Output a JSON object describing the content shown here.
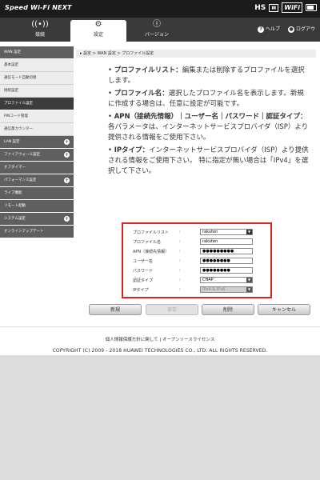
{
  "header": {
    "brand": "Speed Wi-Fi NEXT",
    "network": "HS",
    "wifi_label": "WiFi"
  },
  "nav": {
    "tabs": [
      {
        "label": "接続",
        "icon": "wifi-icon"
      },
      {
        "label": "設定",
        "icon": "gear-icon"
      },
      {
        "label": "バージョン",
        "icon": "info-icon"
      }
    ],
    "help": "ヘルプ",
    "logout": "ログアウ"
  },
  "sidebar": {
    "items": [
      {
        "label": "WAN 設定",
        "type": "section"
      },
      {
        "label": "基本設定",
        "type": "sub"
      },
      {
        "label": "通信モード自動切替",
        "type": "sub"
      },
      {
        "label": "接続設定",
        "type": "sub"
      },
      {
        "label": "プロファイル設定",
        "type": "active"
      },
      {
        "label": "PINコード管理",
        "type": "sub"
      },
      {
        "label": "通信量カウンター",
        "type": "sub"
      },
      {
        "label": "LAN 設定",
        "type": "section",
        "expand": true
      },
      {
        "label": "ファイアウォール設定",
        "type": "section",
        "expand": true
      },
      {
        "label": "オフタイマー",
        "type": "section"
      },
      {
        "label": "パフォーマンス設定",
        "type": "section",
        "expand": true
      },
      {
        "label": "ライブ機能",
        "type": "section"
      },
      {
        "label": "リモート起動",
        "type": "section"
      },
      {
        "label": "システム設定",
        "type": "section",
        "expand": true
      },
      {
        "label": "オンラインアップデート",
        "type": "section"
      }
    ]
  },
  "breadcrumb": "設定 > WAN 設定 > プロファイル設定",
  "info": [
    {
      "term": "プロファイルリスト：",
      "desc": "編集または削除するプロファイルを選択します。"
    },
    {
      "term": "プロファイル名：",
      "desc": "選択したプロファイル名を表示します。新規に作成する場合は、任意に設定が可能です。"
    },
    {
      "term": "APN（接続先情報）｜ユーザー名｜パスワード｜認証タイプ：",
      "desc": "各パラメータは、インターネットサービスプロバイダ（ISP）より提供される情報をご使用下さい。"
    },
    {
      "term": "IPタイプ：",
      "desc": "インターネットサービスプロバイダ（ISP）より提供される情報をご使用下さい。 特に指定が無い場合は「IPv4」を選択して下さい。"
    }
  ],
  "form": {
    "fields": [
      {
        "label": "プロファイルリスト",
        "value": "rakuten",
        "kind": "select"
      },
      {
        "label": "プロファイル名",
        "value": "rakuten",
        "kind": "text"
      },
      {
        "label": "APN（接続先情報）",
        "value": "●●●●●●●●●",
        "kind": "text"
      },
      {
        "label": "ユーザー名",
        "value": "●●●●●●●●",
        "kind": "text"
      },
      {
        "label": "パスワード",
        "value": "●●●●●●●●",
        "kind": "text"
      },
      {
        "label": "認証タイプ",
        "value": "CHAP",
        "kind": "select"
      },
      {
        "label": "IPタイプ",
        "value": "IPv4 & IPv6",
        "kind": "select-disabled"
      }
    ]
  },
  "buttons": {
    "new": "新規",
    "save": "保存",
    "delete": "削除",
    "cancel": "キャンセル"
  },
  "footer": {
    "privacy": "個人情報保護方針に関して",
    "separator": "|",
    "oss": "オープンソースライセンス",
    "copyright": "COPYRIGHT (C) 2009 - 2018 HUAWEI TECHNOLOGIES CO., LTD. ALL RIGHTS RESERVED."
  }
}
